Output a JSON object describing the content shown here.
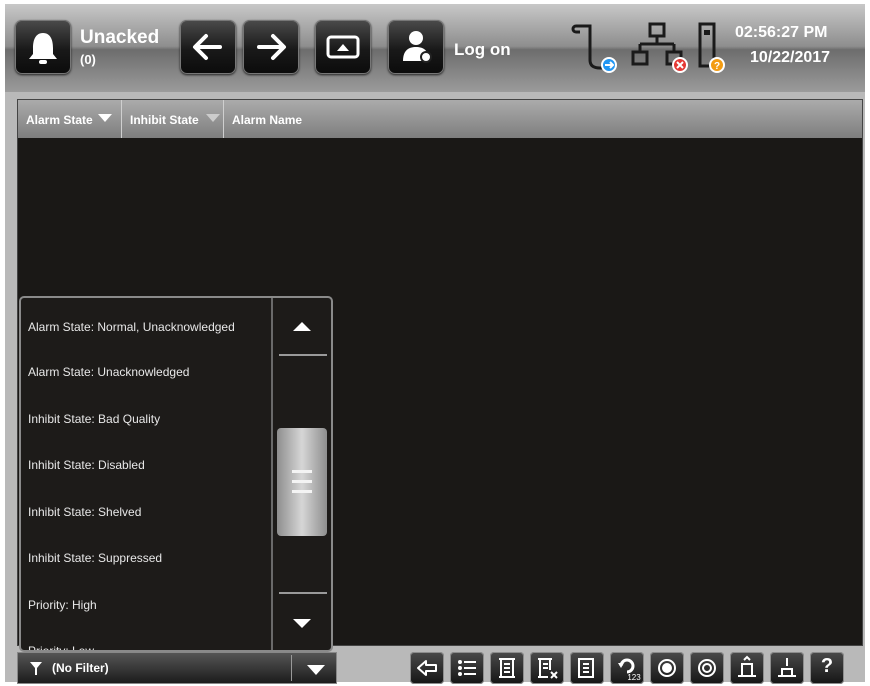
{
  "header": {
    "unacked_title": "Unacked",
    "unacked_count": "(0)",
    "logon_label": "Log on",
    "time": "02:56:27 PM",
    "date": "10/22/2017",
    "icons": [
      "bell-icon",
      "back-arrow-icon",
      "forward-arrow-icon",
      "display-icon",
      "user-icon",
      "log-scroll-icon",
      "network-icon",
      "controller-icon"
    ]
  },
  "alarm_table": {
    "columns": [
      "Alarm State",
      "Inhibit State",
      "Alarm Name"
    ]
  },
  "filter_list": {
    "items": [
      "Alarm State: Normal, Unacknowledged",
      "Alarm State: Unacknowledged",
      "Inhibit State: Bad Quality",
      "Inhibit State: Disabled",
      "Inhibit State: Shelved",
      "Inhibit State: Suppressed",
      "Priority: High",
      "Priority: Low"
    ]
  },
  "filter_dropdown": {
    "selected": "(No Filter)"
  },
  "toolbar": {
    "help_label": "?",
    "icons": [
      "return-icon",
      "list-icon",
      "acknowledge-icon",
      "clear-icon",
      "page-icon",
      "refresh-123-icon",
      "record-icon",
      "ring-icon",
      "shelve-icon",
      "unshelve-icon",
      "help-icon"
    ]
  },
  "colors": {
    "status_blue": "#2196f3",
    "status_red": "#e53935",
    "status_orange": "#f39c12",
    "background_dark": "#1a1816"
  }
}
